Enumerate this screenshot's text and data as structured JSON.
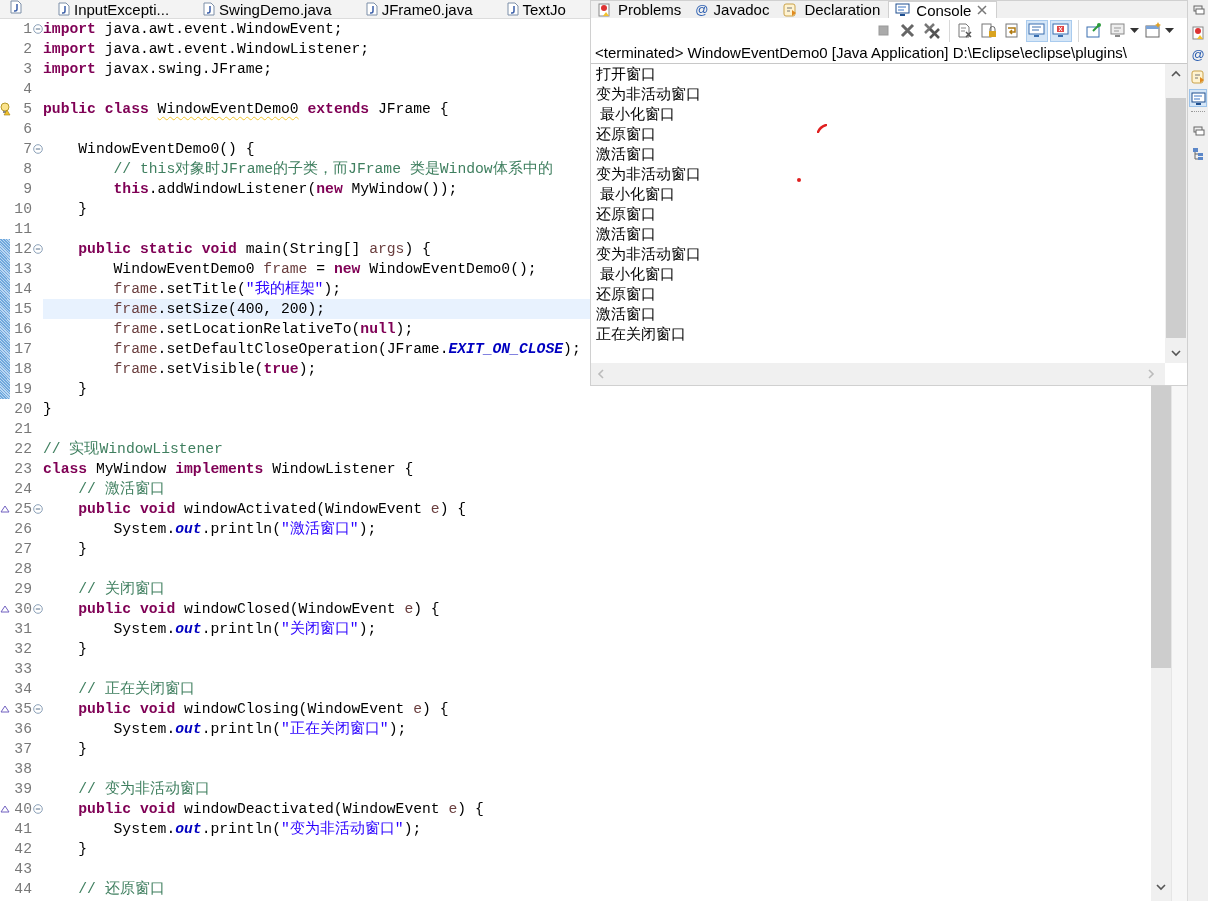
{
  "editor": {
    "tabs": [
      {
        "label": "InputExcepti...",
        "selected": false
      },
      {
        "label": "SwingDemo.java",
        "selected": false
      },
      {
        "label": "JFrame0.java",
        "selected": false
      },
      {
        "label": "TextJo",
        "selected": false
      }
    ],
    "lines": [
      {
        "number": "1",
        "fold": true,
        "override": false,
        "warning": false,
        "changed": false,
        "current": false,
        "tokens": [
          {
            "kind": "keyword",
            "text": "import"
          },
          {
            "kind": "plain",
            "text": " java.awt.event.WindowEvent;"
          }
        ]
      },
      {
        "number": "2",
        "fold": false,
        "override": false,
        "warning": false,
        "changed": false,
        "current": false,
        "tokens": [
          {
            "kind": "keyword",
            "text": "import"
          },
          {
            "kind": "plain",
            "text": " java.awt.event.WindowListener;"
          }
        ]
      },
      {
        "number": "3",
        "fold": false,
        "override": false,
        "warning": false,
        "changed": false,
        "current": false,
        "tokens": [
          {
            "kind": "keyword",
            "text": "import"
          },
          {
            "kind": "plain",
            "text": " javax.swing.JFrame;"
          }
        ]
      },
      {
        "number": "4",
        "fold": false,
        "override": false,
        "warning": false,
        "changed": false,
        "current": false
      },
      {
        "number": "5",
        "fold": false,
        "override": false,
        "warning": true,
        "changed": false,
        "current": false,
        "tokens": [
          {
            "kind": "keyword",
            "text": "public class "
          },
          {
            "kind": "flagged",
            "text": "WindowEventDemo0"
          },
          {
            "kind": "keyword",
            "text": " extends"
          },
          {
            "kind": "plain",
            "text": " JFrame {"
          }
        ]
      },
      {
        "number": "6",
        "fold": false,
        "override": false,
        "warning": false,
        "changed": false,
        "current": false
      },
      {
        "number": "7",
        "fold": true,
        "override": false,
        "warning": false,
        "changed": false,
        "current": false,
        "tokens": [
          {
            "kind": "plain",
            "text": "    WindowEventDemo0() {"
          }
        ]
      },
      {
        "number": "8",
        "fold": false,
        "override": false,
        "warning": false,
        "changed": false,
        "current": false,
        "tokens": [
          {
            "kind": "comment",
            "text": "        // this对象时JFrame的子类，而JFrame 类是Window体系中的"
          }
        ]
      },
      {
        "number": "9",
        "fold": false,
        "override": false,
        "warning": false,
        "changed": false,
        "current": false,
        "tokens": [
          {
            "kind": "keyword",
            "text": "        this"
          },
          {
            "kind": "plain",
            "text": ".addWindowListener("
          },
          {
            "kind": "keyword",
            "text": "new"
          },
          {
            "kind": "plain",
            "text": " MyWindow());"
          }
        ]
      },
      {
        "number": "10",
        "fold": false,
        "override": false,
        "warning": false,
        "changed": false,
        "current": false,
        "tokens": [
          {
            "kind": "plain",
            "text": "    }"
          }
        ]
      },
      {
        "number": "11",
        "fold": false,
        "override": false,
        "warning": false,
        "changed": false,
        "current": false
      },
      {
        "number": "12",
        "fold": true,
        "override": false,
        "warning": false,
        "changed": true,
        "current": false,
        "tokens": [
          {
            "kind": "keyword",
            "text": "    public static void"
          },
          {
            "kind": "plain",
            "text": " main(String[] "
          },
          {
            "kind": "variable",
            "text": "args"
          },
          {
            "kind": "plain",
            "text": ") {"
          }
        ]
      },
      {
        "number": "13",
        "fold": false,
        "override": false,
        "warning": false,
        "changed": true,
        "current": false,
        "tokens": [
          {
            "kind": "plain",
            "text": "        WindowEventDemo0 "
          },
          {
            "kind": "variable",
            "text": "frame"
          },
          {
            "kind": "plain",
            "text": " = "
          },
          {
            "kind": "keyword",
            "text": "new"
          },
          {
            "kind": "plain",
            "text": " WindowEventDemo0();"
          }
        ]
      },
      {
        "number": "14",
        "fold": false,
        "override": false,
        "warning": false,
        "changed": true,
        "current": false,
        "tokens": [
          {
            "kind": "variable",
            "text": "        frame"
          },
          {
            "kind": "plain",
            "text": ".setTitle("
          },
          {
            "kind": "string",
            "text": "\"我的框架\""
          },
          {
            "kind": "plain",
            "text": ");"
          }
        ]
      },
      {
        "number": "15",
        "fold": false,
        "override": false,
        "warning": false,
        "changed": true,
        "current": true,
        "tokens": [
          {
            "kind": "variable",
            "text": "        frame"
          },
          {
            "kind": "plain",
            "text": ".setSize(400, 200);"
          }
        ]
      },
      {
        "number": "16",
        "fold": false,
        "override": false,
        "warning": false,
        "changed": true,
        "current": false,
        "tokens": [
          {
            "kind": "variable",
            "text": "        frame"
          },
          {
            "kind": "plain",
            "text": ".setLocationRelativeTo("
          },
          {
            "kind": "keyword",
            "text": "null"
          },
          {
            "kind": "plain",
            "text": ");"
          }
        ]
      },
      {
        "number": "17",
        "fold": false,
        "override": false,
        "warning": false,
        "changed": true,
        "current": false,
        "tokens": [
          {
            "kind": "variable",
            "text": "        frame"
          },
          {
            "kind": "plain",
            "text": ".setDefaultCloseOperation(JFrame."
          },
          {
            "kind": "field",
            "text": "EXIT_ON_CLOSE"
          },
          {
            "kind": "plain",
            "text": ");"
          }
        ]
      },
      {
        "number": "18",
        "fold": false,
        "override": false,
        "warning": false,
        "changed": true,
        "current": false,
        "tokens": [
          {
            "kind": "variable",
            "text": "        frame"
          },
          {
            "kind": "plain",
            "text": ".setVisible("
          },
          {
            "kind": "keyword",
            "text": "true"
          },
          {
            "kind": "plain",
            "text": ");"
          }
        ]
      },
      {
        "number": "19",
        "fold": false,
        "override": false,
        "warning": false,
        "changed": true,
        "current": false,
        "tokens": [
          {
            "kind": "plain",
            "text": "    }"
          }
        ]
      },
      {
        "number": "20",
        "fold": false,
        "override": false,
        "warning": false,
        "changed": false,
        "current": false,
        "tokens": [
          {
            "kind": "plain",
            "text": "}"
          }
        ]
      },
      {
        "number": "21",
        "fold": false,
        "override": false,
        "warning": false,
        "changed": false,
        "current": false
      },
      {
        "number": "22",
        "fold": false,
        "override": false,
        "warning": false,
        "changed": false,
        "current": false,
        "tokens": [
          {
            "kind": "comment",
            "text": "// 实现WindowListener"
          }
        ]
      },
      {
        "number": "23",
        "fold": false,
        "override": false,
        "warning": false,
        "changed": false,
        "current": false,
        "tokens": [
          {
            "kind": "keyword",
            "text": "class"
          },
          {
            "kind": "plain",
            "text": " MyWindow "
          },
          {
            "kind": "keyword",
            "text": "implements"
          },
          {
            "kind": "plain",
            "text": " WindowListener {"
          }
        ]
      },
      {
        "number": "24",
        "fold": false,
        "override": false,
        "warning": false,
        "changed": false,
        "current": false,
        "tokens": [
          {
            "kind": "comment",
            "text": "    // 激活窗口"
          }
        ]
      },
      {
        "number": "25",
        "fold": true,
        "override": true,
        "warning": false,
        "changed": false,
        "current": false,
        "tokens": [
          {
            "kind": "keyword",
            "text": "    public void"
          },
          {
            "kind": "plain",
            "text": " windowActivated(WindowEvent "
          },
          {
            "kind": "variable",
            "text": "e"
          },
          {
            "kind": "plain",
            "text": ") {"
          }
        ]
      },
      {
        "number": "26",
        "fold": false,
        "override": false,
        "warning": false,
        "changed": false,
        "current": false,
        "tokens": [
          {
            "kind": "plain",
            "text": "        System."
          },
          {
            "kind": "field",
            "text": "out"
          },
          {
            "kind": "plain",
            "text": ".println("
          },
          {
            "kind": "string",
            "text": "\"激活窗口\""
          },
          {
            "kind": "plain",
            "text": ");"
          }
        ]
      },
      {
        "number": "27",
        "fold": false,
        "override": false,
        "warning": false,
        "changed": false,
        "current": false,
        "tokens": [
          {
            "kind": "plain",
            "text": "    }"
          }
        ]
      },
      {
        "number": "28",
        "fold": false,
        "override": false,
        "warning": false,
        "changed": false,
        "current": false
      },
      {
        "number": "29",
        "fold": false,
        "override": false,
        "warning": false,
        "changed": false,
        "current": false,
        "tokens": [
          {
            "kind": "comment",
            "text": "    // 关闭窗口"
          }
        ]
      },
      {
        "number": "30",
        "fold": true,
        "override": true,
        "warning": false,
        "changed": false,
        "current": false,
        "tokens": [
          {
            "kind": "keyword",
            "text": "    public void"
          },
          {
            "kind": "plain",
            "text": " windowClosed(WindowEvent "
          },
          {
            "kind": "variable",
            "text": "e"
          },
          {
            "kind": "plain",
            "text": ") {"
          }
        ]
      },
      {
        "number": "31",
        "fold": false,
        "override": false,
        "warning": false,
        "changed": false,
        "current": false,
        "tokens": [
          {
            "kind": "plain",
            "text": "        System."
          },
          {
            "kind": "field",
            "text": "out"
          },
          {
            "kind": "plain",
            "text": ".println("
          },
          {
            "kind": "string",
            "text": "\"关闭窗口\""
          },
          {
            "kind": "plain",
            "text": ");"
          }
        ]
      },
      {
        "number": "32",
        "fold": false,
        "override": false,
        "warning": false,
        "changed": false,
        "current": false,
        "tokens": [
          {
            "kind": "plain",
            "text": "    }"
          }
        ]
      },
      {
        "number": "33",
        "fold": false,
        "override": false,
        "warning": false,
        "changed": false,
        "current": false
      },
      {
        "number": "34",
        "fold": false,
        "override": false,
        "warning": false,
        "changed": false,
        "current": false,
        "tokens": [
          {
            "kind": "comment",
            "text": "    // 正在关闭窗口"
          }
        ]
      },
      {
        "number": "35",
        "fold": true,
        "override": true,
        "warning": false,
        "changed": false,
        "current": false,
        "tokens": [
          {
            "kind": "keyword",
            "text": "    public void"
          },
          {
            "kind": "plain",
            "text": " windowClosing(WindowEvent "
          },
          {
            "kind": "variable",
            "text": "e"
          },
          {
            "kind": "plain",
            "text": ") {"
          }
        ]
      },
      {
        "number": "36",
        "fold": false,
        "override": false,
        "warning": false,
        "changed": false,
        "current": false,
        "tokens": [
          {
            "kind": "plain",
            "text": "        System."
          },
          {
            "kind": "field",
            "text": "out"
          },
          {
            "kind": "plain",
            "text": ".println("
          },
          {
            "kind": "string",
            "text": "\"正在关闭窗口\""
          },
          {
            "kind": "plain",
            "text": ");"
          }
        ]
      },
      {
        "number": "37",
        "fold": false,
        "override": false,
        "warning": false,
        "changed": false,
        "current": false,
        "tokens": [
          {
            "kind": "plain",
            "text": "    }"
          }
        ]
      },
      {
        "number": "38",
        "fold": false,
        "override": false,
        "warning": false,
        "changed": false,
        "current": false
      },
      {
        "number": "39",
        "fold": false,
        "override": false,
        "warning": false,
        "changed": false,
        "current": false,
        "tokens": [
          {
            "kind": "comment",
            "text": "    // 变为非活动窗口"
          }
        ]
      },
      {
        "number": "40",
        "fold": true,
        "override": true,
        "warning": false,
        "changed": false,
        "current": false,
        "tokens": [
          {
            "kind": "keyword",
            "text": "    public void"
          },
          {
            "kind": "plain",
            "text": " windowDeactivated(WindowEvent "
          },
          {
            "kind": "variable",
            "text": "e"
          },
          {
            "kind": "plain",
            "text": ") {"
          }
        ]
      },
      {
        "number": "41",
        "fold": false,
        "override": false,
        "warning": false,
        "changed": false,
        "current": false,
        "tokens": [
          {
            "kind": "plain",
            "text": "        System."
          },
          {
            "kind": "field",
            "text": "out"
          },
          {
            "kind": "plain",
            "text": ".println("
          },
          {
            "kind": "string",
            "text": "\"变为非活动窗口\""
          },
          {
            "kind": "plain",
            "text": ");"
          }
        ]
      },
      {
        "number": "42",
        "fold": false,
        "override": false,
        "warning": false,
        "changed": false,
        "current": false,
        "tokens": [
          {
            "kind": "plain",
            "text": "    }"
          }
        ]
      },
      {
        "number": "43",
        "fold": false,
        "override": false,
        "warning": false,
        "changed": false,
        "current": false
      },
      {
        "number": "44",
        "fold": false,
        "override": false,
        "warning": false,
        "changed": false,
        "current": false,
        "tokens": [
          {
            "kind": "comment",
            "text": "    // 还原窗口"
          }
        ]
      }
    ]
  },
  "console": {
    "tabs": [
      {
        "label": "Problems",
        "kind": "problems",
        "selected": false
      },
      {
        "label": "Javadoc",
        "kind": "glyph",
        "glyph": "@",
        "selected": false
      },
      {
        "label": "Declaration",
        "kind": "declaration",
        "selected": false
      },
      {
        "label": "Console",
        "kind": "console",
        "selected": true
      }
    ],
    "toolbar": [
      [
        {
          "kind": "stop",
          "pressed": false
        },
        {
          "kind": "remove",
          "pressed": false
        },
        {
          "kind": "remove_all",
          "pressed": false
        }
      ],
      [
        {
          "kind": "clear",
          "pressed": false
        },
        {
          "kind": "scroll_lock",
          "pressed": false
        },
        {
          "kind": "word_wrap",
          "pressed": false
        },
        {
          "kind": "stdout",
          "pressed": true
        },
        {
          "kind": "stderr",
          "pressed": true
        }
      ],
      [
        {
          "kind": "pin",
          "pressed": false
        },
        {
          "kind": "display",
          "pressed": false
        },
        {
          "kind": "dropdown",
          "pressed": false
        },
        {
          "kind": "open",
          "pressed": false
        },
        {
          "kind": "dropdown",
          "pressed": false
        }
      ]
    ],
    "process": "<terminated> WindowEventDemo0 [Java Application] D:\\Eclipse\\eclipse\\plugins\\",
    "output": [
      "打开窗口",
      "变为非活动窗口",
      " 最小化窗口",
      "还原窗口",
      "激活窗口",
      "变为非活动窗口",
      " 最小化窗口",
      "还原窗口",
      "激活窗口",
      "变为非活动窗口",
      " 最小化窗口",
      "还原窗口",
      "激活窗口",
      "正在关闭窗口"
    ]
  },
  "trim": [
    {
      "kind": "restore",
      "selected": false
    },
    {
      "kind": "problems",
      "selected": false
    },
    {
      "kind": "glyph",
      "glyph": "@",
      "selected": false
    },
    {
      "kind": "declaration",
      "selected": false
    },
    {
      "kind": "console",
      "selected": true
    },
    {
      "kind": "restore",
      "selected": false
    },
    {
      "kind": "outline",
      "selected": false
    }
  ]
}
